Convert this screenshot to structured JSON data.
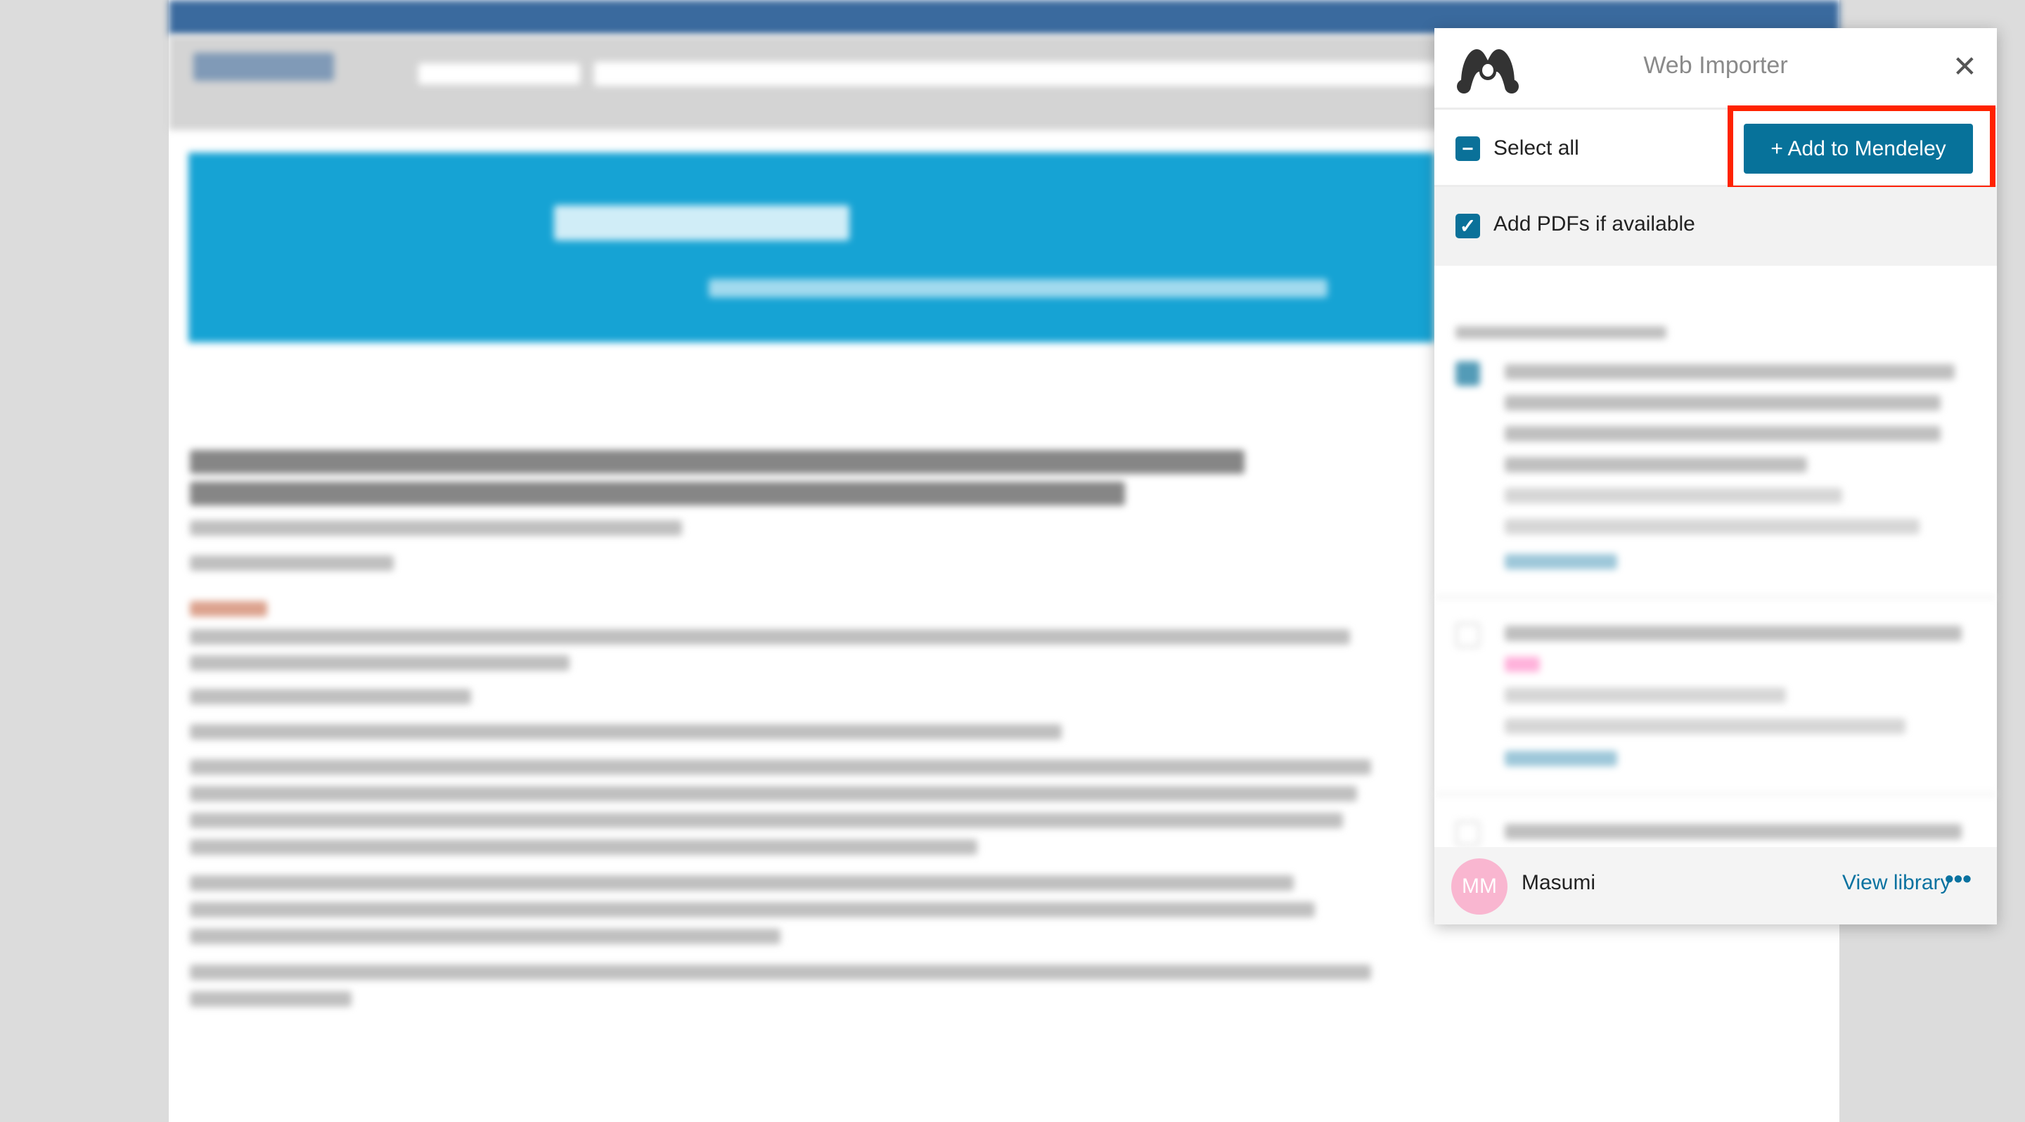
{
  "importer": {
    "title": "Web Importer",
    "close_icon": "close-icon",
    "logo_icon": "mendeley-logo-icon",
    "select_all": {
      "label": "Select all",
      "state": "indeterminate"
    },
    "add_button": {
      "label": "+ Add to Mendeley"
    },
    "add_pdfs": {
      "label": "Add PDFs if available",
      "checked": true
    },
    "accent_color": "#07729a",
    "highlight_color": "#ff2200",
    "references": [
      {
        "checked": true
      },
      {
        "checked": false
      },
      {
        "checked": false
      }
    ],
    "footer": {
      "avatar_initials": "MM",
      "user_name": "Masumi",
      "view_library": "View library",
      "more_icon": "more-icon"
    }
  }
}
